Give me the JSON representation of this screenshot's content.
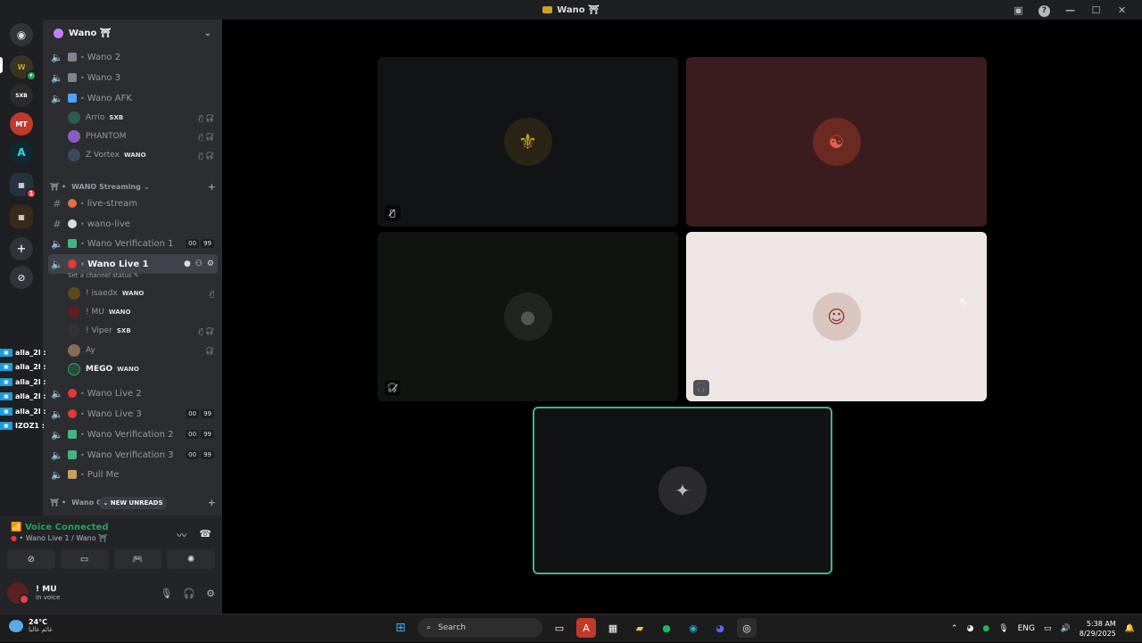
{
  "window": {
    "title": "Wano ⛩"
  },
  "server": {
    "name": "Wano ⛩"
  },
  "channels": [
    {
      "label": "Wano 2",
      "type": "voice",
      "emoji_color": "#80848e"
    },
    {
      "label": "Wano 3",
      "type": "voice",
      "emoji_color": "#80848e"
    },
    {
      "label": "Wano AFK",
      "type": "voice",
      "emoji_color": "#4fa3ff"
    }
  ],
  "afk_users": [
    {
      "name": "Arrio",
      "tag": "SXB",
      "avatar": "#2f5c4d"
    },
    {
      "name": "PHANTOM",
      "tag": "",
      "avatar": "#8a5cc7"
    },
    {
      "name": "Z Vortex",
      "tag": "WANO",
      "avatar": "#3b4a5c"
    }
  ],
  "category_streaming": "WANO Streaming",
  "text_channels": [
    {
      "label": "live-stream"
    },
    {
      "label": "wano-live"
    }
  ],
  "verification1": {
    "label": "Wano Verification 1",
    "count_a": "00",
    "count_b": "99"
  },
  "live1": {
    "label": "Wano Live 1",
    "status": "Set a channel status"
  },
  "live1_users": [
    {
      "name": "! isaedx",
      "tag": "WANO",
      "avatar": "#5a4a1a"
    },
    {
      "name": "! MU",
      "tag": "WANO",
      "avatar": "#5b2020"
    },
    {
      "name": "! Viper",
      "tag": "SXB",
      "avatar": "#333"
    },
    {
      "name": "Ay",
      "tag": "",
      "avatar": "#8a6a5a"
    },
    {
      "name": "MEGO",
      "tag": "WANO",
      "avatar": "#2a4a3a"
    }
  ],
  "more_channels": [
    {
      "label": "Wano Live 2",
      "emoji_color": "#e53935"
    },
    {
      "label": "Wano Live 3",
      "emoji_color": "#e53935",
      "count_a": "00",
      "count_b": "99"
    },
    {
      "label": "Wano Verification 2",
      "emoji_color": "#43b581",
      "count_a": "00",
      "count_b": "99"
    },
    {
      "label": "Wano Verification 3",
      "emoji_color": "#43b581",
      "count_a": "00",
      "count_b": "99"
    },
    {
      "label": "Pull Me",
      "emoji_color": "#c8a060"
    }
  ],
  "category_bottom": "Wano C",
  "new_unreads": "NEW UNREADS",
  "overlay_names": [
    "alla_2l :",
    "alla_2l :",
    "alla_2l :",
    "alla_2l :",
    "alla_2l :",
    "IZOZ1 :"
  ],
  "overlay_badge": "▣",
  "voice": {
    "status": "Voice Connected",
    "location": "Wano Live 1 / Wano ⛩"
  },
  "user": {
    "name": "! MU",
    "status": "In voice"
  },
  "tiles": [
    {
      "bg": "#111315",
      "avatar_bg": "#2a2416",
      "avatar_color": "#c9a227",
      "mic": "🎙"
    },
    {
      "bg": "#3a1c1e",
      "avatar_bg": "#6a2a22",
      "avatar_color": "#e06050",
      "mic": ""
    },
    {
      "bg": "#0f1411",
      "avatar_bg": "#1f2622",
      "avatar_color": "#555",
      "mic": "🎙"
    },
    {
      "bg": "#ede6e4",
      "avatar_bg": "#d9c6c0",
      "avatar_color": "#8a3a30",
      "mic": "🎙"
    },
    {
      "bg": "#111214",
      "avatar_bg": "#2b2b2d",
      "avatar_color": "#bbb",
      "mic": ""
    }
  ],
  "taskbar": {
    "temp": "24°C",
    "weather_desc": "غائم غالبا",
    "search": "Search",
    "lang": "ENG",
    "time": "5:38 AM",
    "date": "8/29/2025"
  }
}
